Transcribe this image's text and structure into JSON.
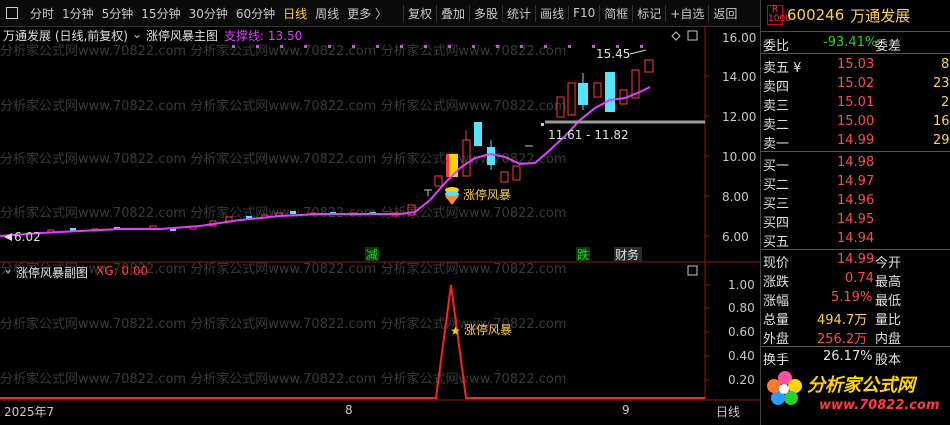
{
  "toolbar": {
    "items": [
      "分时",
      "1分钟",
      "5分钟",
      "15分钟",
      "30分钟",
      "60分钟",
      "日线",
      "周线",
      "更多 〉"
    ],
    "active": "日线",
    "right_items": [
      "复权",
      "叠加",
      "多股",
      "统计",
      "画线",
      "F10",
      "简框",
      "标记",
      "+自选",
      "返回"
    ]
  },
  "main_chart": {
    "title": "万通发展 (日线,前复权)",
    "indicator_name": "涨停风暴主图",
    "support_label": "支撑线: 13.50",
    "high_label": "15.45",
    "low_label": "6.02",
    "range_label": "11.61 - 11.82",
    "signal_label": "涨停风暴",
    "markers": [
      "减",
      "跌",
      "财务"
    ],
    "price_scale": [
      "16.00",
      "14.00",
      "12.00",
      "10.00",
      "8.00",
      "6.00"
    ],
    "colors": {
      "up": "#ff3b3b",
      "down": "#54e4ff",
      "line": "#e040ff",
      "limit_up": "#ffd400"
    }
  },
  "sub_chart": {
    "title": "涨停风暴副图",
    "xg_label": "XG: 0.00",
    "signal_label": "涨停风暴",
    "scale": [
      "1.00",
      "0.80",
      "0.60",
      "0.40",
      "0.20"
    ]
  },
  "time_axis": {
    "labels": [
      "2025年7",
      "8",
      "9"
    ],
    "mode": "日线"
  },
  "stock": {
    "badge": "R\n1000",
    "code": "600246",
    "name": "万通发展"
  },
  "order_book": {
    "ratio_label": "委比",
    "ratio_value": "-93.41%",
    "diff_label": "委差",
    "asks": [
      {
        "label": "卖五 ¥",
        "price": "15.03",
        "vol": "8"
      },
      {
        "label": "卖四",
        "price": "15.02",
        "vol": "23"
      },
      {
        "label": "卖三",
        "price": "15.01",
        "vol": "2"
      },
      {
        "label": "卖二",
        "price": "15.00",
        "vol": "16"
      },
      {
        "label": "卖一",
        "price": "14.99",
        "vol": "29"
      }
    ],
    "bids": [
      {
        "label": "买一",
        "price": "14.98"
      },
      {
        "label": "买二",
        "price": "14.97"
      },
      {
        "label": "买三",
        "price": "14.96"
      },
      {
        "label": "买四",
        "price": "14.95"
      },
      {
        "label": "买五",
        "price": "14.94"
      }
    ]
  },
  "quote": {
    "rows": [
      {
        "l1": "现价",
        "v1": "14.99",
        "l2": "今开"
      },
      {
        "l1": "涨跌",
        "v1": "0.74",
        "l2": "最高"
      },
      {
        "l1": "涨幅",
        "v1": "5.19%",
        "l2": "最低"
      },
      {
        "l1": "总量",
        "v1": "494.7万",
        "l2": "量比"
      },
      {
        "l1": "外盘",
        "v1": "256.2万",
        "l2": "内盘"
      },
      {
        "l1": "换手",
        "v1": "26.17%",
        "l2": "股本"
      }
    ]
  },
  "logo": {
    "text": "分析家公式网",
    "url": "www.70822.com"
  },
  "watermark": "分析家公式网www.70822.com"
}
